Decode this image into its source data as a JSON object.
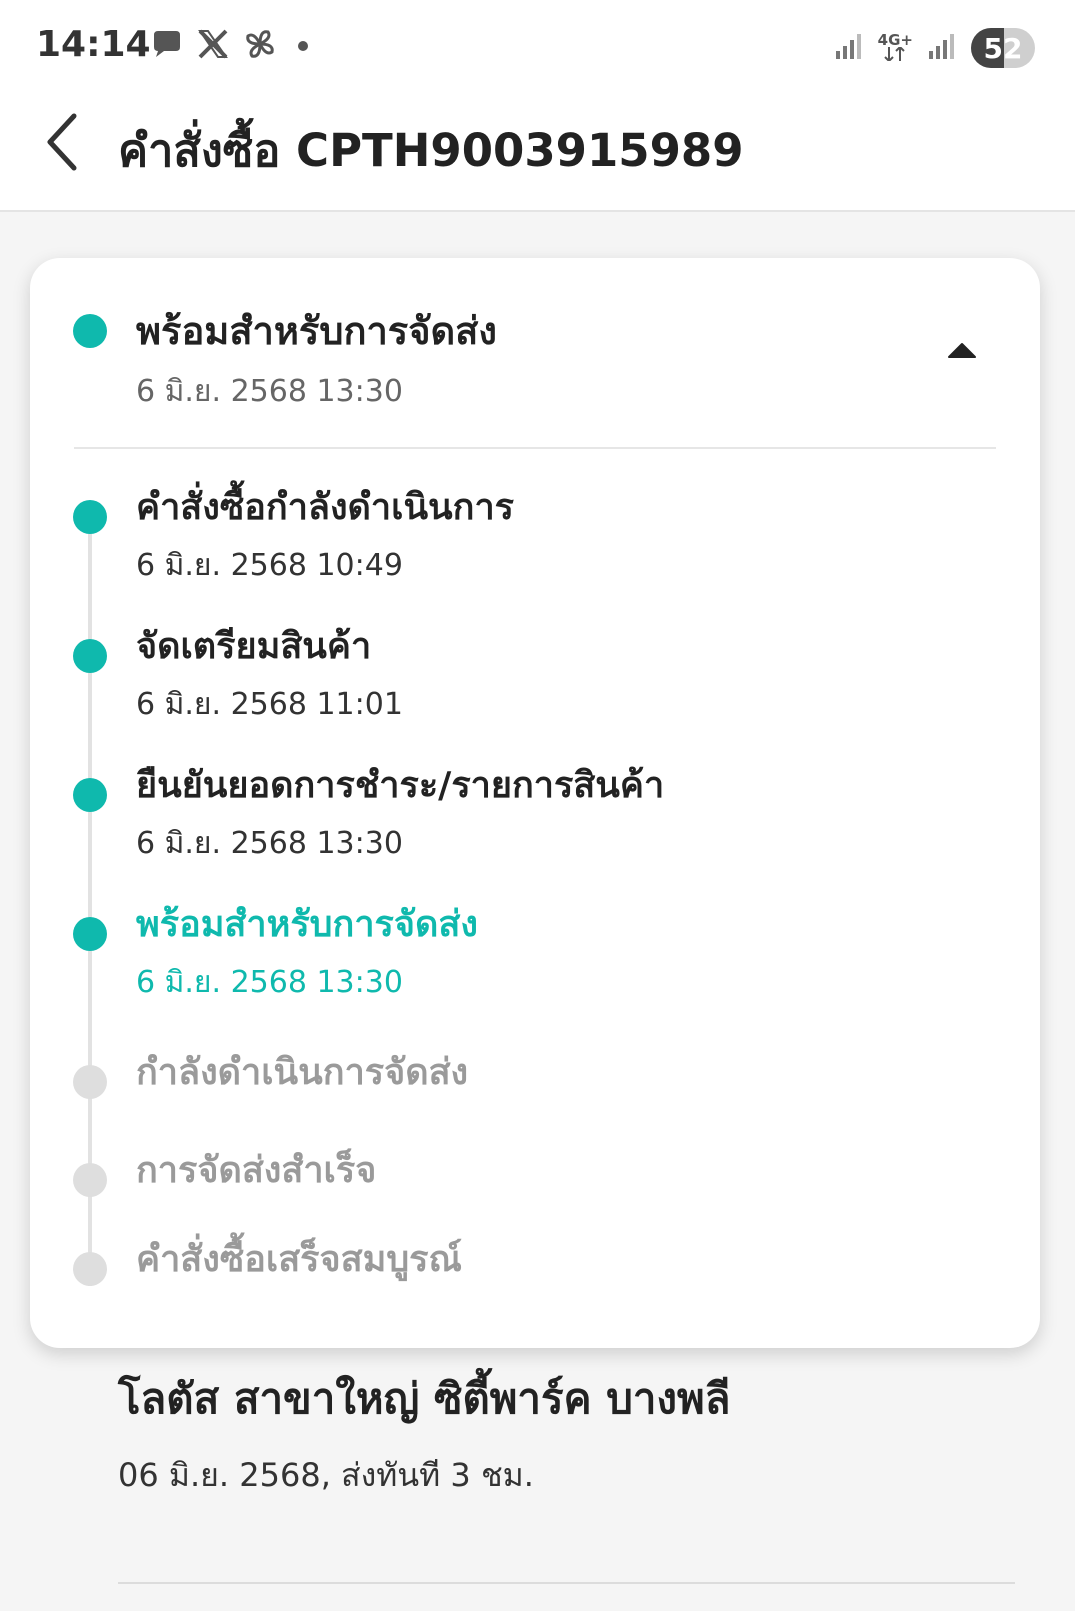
{
  "status_bar": {
    "time": "14:14",
    "left_icons": [
      "chat-bubble-icon",
      "x-logo-icon",
      "pinwheel-icon",
      "notification-dot-icon"
    ],
    "network_label": "4G+",
    "battery": "52",
    "battery_level": 0.52
  },
  "header": {
    "back_icon": "chevron-left-icon",
    "title": "คำสั่งซื้อ CPTH9003915989"
  },
  "order_status": {
    "current_status": "พร้อมสำหรับการจัดส่ง",
    "current_time": "6 มิ.ย. 2568 13:30",
    "collapse_icon": "caret-up-icon",
    "accent_color": "#0fb9ad",
    "steps": [
      {
        "label": "คำสั่งซื้อกำลังดำเนินการ",
        "time": "6 มิ.ย. 2568 10:49",
        "state": "done"
      },
      {
        "label": "จัดเตรียมสินค้า",
        "time": "6 มิ.ย. 2568 11:01",
        "state": "done"
      },
      {
        "label": "ยืนยันยอดการชำระ/รายการสินค้า",
        "time": "6 มิ.ย. 2568 13:30",
        "state": "done"
      },
      {
        "label": "พร้อมสำหรับการจัดส่ง",
        "time": "6 มิ.ย. 2568 13:30",
        "state": "current"
      },
      {
        "label": "กำลังดำเนินการจัดส่ง",
        "state": "pending"
      },
      {
        "label": "การจัดส่งสำเร็จ",
        "state": "pending"
      },
      {
        "label": "คำสั่งซื้อเสร็จสมบูรณ์",
        "state": "pending"
      }
    ]
  },
  "store": {
    "name": "โลตัส สาขาใหญ่ ซิตี้พาร์ค บางพลี",
    "delivery": "06 มิ.ย. 2568, ส่งทันที 3 ชม."
  }
}
